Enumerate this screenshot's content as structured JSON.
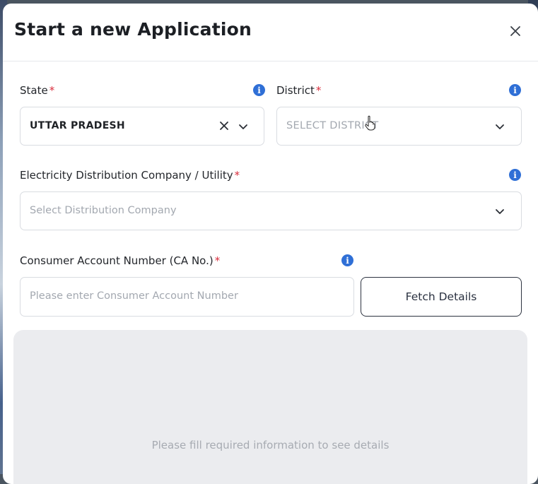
{
  "modal": {
    "title": "Start a new Application",
    "close_icon": "close-icon"
  },
  "state": {
    "label": "State",
    "required_mark": "*",
    "value": "UTTAR PRADESH",
    "info_icon": "info-icon"
  },
  "district": {
    "label": "District",
    "required_mark": "*",
    "placeholder": "SELECT DISTRICT",
    "info_icon": "info-icon"
  },
  "utility": {
    "label": "Electricity Distribution Company / Utility",
    "required_mark": "*",
    "placeholder": "Select Distribution Company",
    "info_icon": "info-icon"
  },
  "consumer": {
    "label": "Consumer Account Number (CA No.)",
    "required_mark": "*",
    "placeholder": "Please enter Consumer Account Number",
    "info_icon": "info-icon",
    "fetch_button": "Fetch Details"
  },
  "details": {
    "message": "Please fill required information to see details"
  },
  "colors": {
    "required": "#d92d3c",
    "info": "#2f6fd6",
    "panel": "#ebecef"
  }
}
